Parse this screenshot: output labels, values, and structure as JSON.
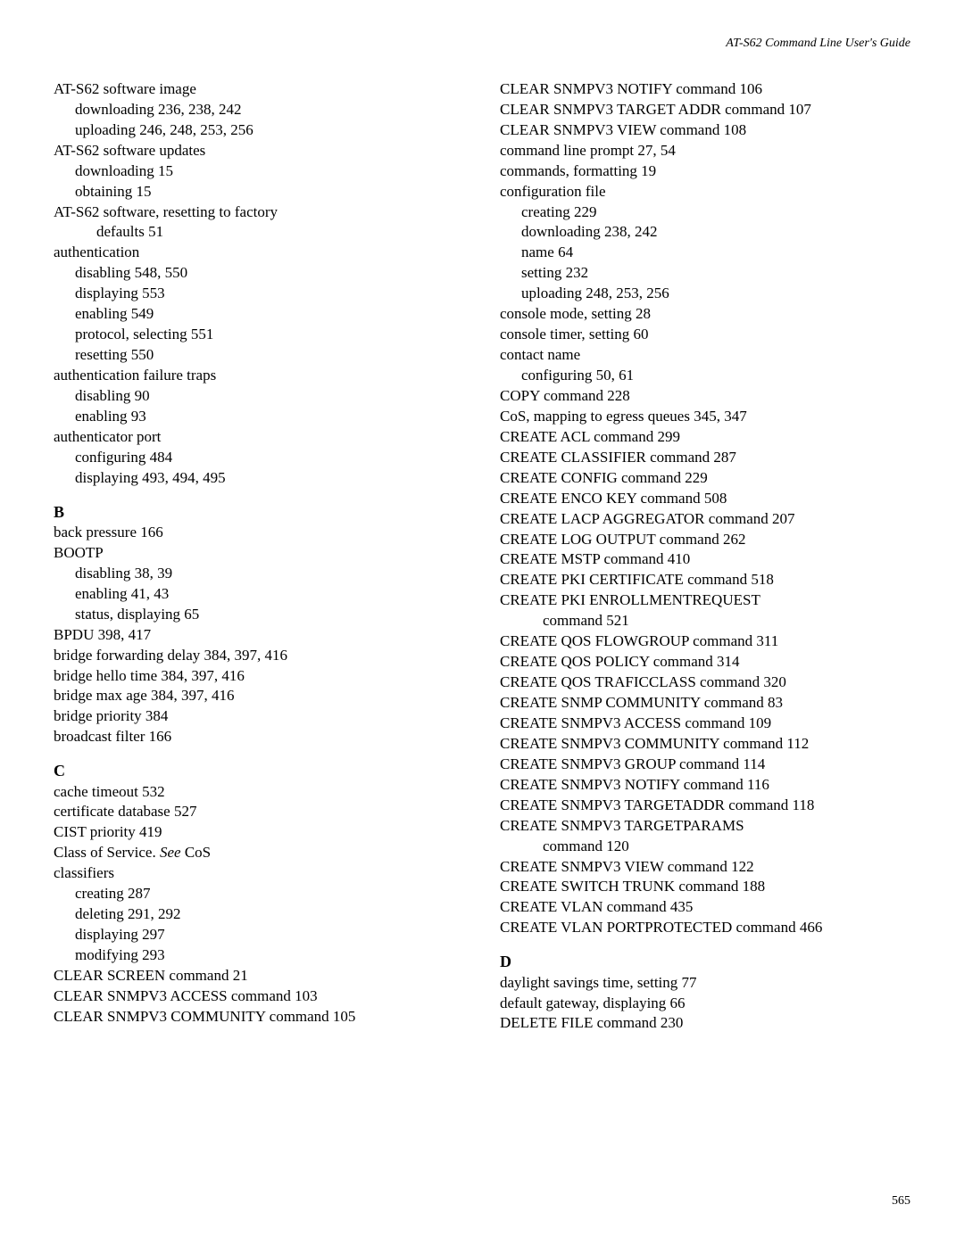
{
  "header": "AT-S62 Command Line User's Guide",
  "page_number": "565",
  "left_column": [
    {
      "text": "AT-S62 software image",
      "indent": 0
    },
    {
      "text": "downloading 236, 238, 242",
      "indent": 1
    },
    {
      "text": "uploading 246, 248, 253, 256",
      "indent": 1
    },
    {
      "text": "AT-S62 software updates",
      "indent": 0
    },
    {
      "text": "downloading 15",
      "indent": 1
    },
    {
      "text": "obtaining 15",
      "indent": 1
    },
    {
      "text": "AT-S62 software, resetting to factory",
      "indent": 0
    },
    {
      "text": "defaults 51",
      "indent": 2
    },
    {
      "text": "authentication",
      "indent": 0
    },
    {
      "text": "disabling 548, 550",
      "indent": 1
    },
    {
      "text": "displaying 553",
      "indent": 1
    },
    {
      "text": "enabling 549",
      "indent": 1
    },
    {
      "text": "protocol, selecting 551",
      "indent": 1
    },
    {
      "text": "resetting 550",
      "indent": 1
    },
    {
      "text": "authentication failure traps",
      "indent": 0
    },
    {
      "text": "disabling 90",
      "indent": 1
    },
    {
      "text": "enabling 93",
      "indent": 1
    },
    {
      "text": "authenticator port",
      "indent": 0
    },
    {
      "text": "configuring 484",
      "indent": 1
    },
    {
      "text": "displaying 493, 494, 495",
      "indent": 1
    },
    {
      "text": "B",
      "indent": 0,
      "section": true
    },
    {
      "text": "back pressure 166",
      "indent": 0
    },
    {
      "text": "BOOTP",
      "indent": 0
    },
    {
      "text": "disabling 38, 39",
      "indent": 1
    },
    {
      "text": "enabling 41, 43",
      "indent": 1
    },
    {
      "text": "status, displaying 65",
      "indent": 1
    },
    {
      "text": "BPDU 398, 417",
      "indent": 0
    },
    {
      "text": "bridge forwarding delay 384, 397, 416",
      "indent": 0
    },
    {
      "text": "bridge hello time 384, 397, 416",
      "indent": 0
    },
    {
      "text": "bridge max age 384, 397, 416",
      "indent": 0
    },
    {
      "text": "bridge priority 384",
      "indent": 0
    },
    {
      "text": "broadcast filter 166",
      "indent": 0
    },
    {
      "text": "C",
      "indent": 0,
      "section": true
    },
    {
      "text": "cache timeout 532",
      "indent": 0
    },
    {
      "text": "certificate database 527",
      "indent": 0
    },
    {
      "text": "CIST priority 419",
      "indent": 0
    },
    {
      "text": "Class of Service. ",
      "indent": 0,
      "see": "See",
      "suffix": " CoS"
    },
    {
      "text": "classifiers",
      "indent": 0
    },
    {
      "text": "creating 287",
      "indent": 1
    },
    {
      "text": "deleting 291, 292",
      "indent": 1
    },
    {
      "text": "displaying 297",
      "indent": 1
    },
    {
      "text": "modifying 293",
      "indent": 1
    },
    {
      "text": "CLEAR SCREEN command 21",
      "indent": 0
    },
    {
      "text": "CLEAR SNMPV3 ACCESS command 103",
      "indent": 0
    },
    {
      "text": "CLEAR SNMPV3 COMMUNITY command 105",
      "indent": 0
    }
  ],
  "right_column": [
    {
      "text": "CLEAR SNMPV3 NOTIFY command 106",
      "indent": 0
    },
    {
      "text": "CLEAR SNMPV3 TARGET ADDR command 107",
      "indent": 0
    },
    {
      "text": "CLEAR SNMPV3 VIEW command 108",
      "indent": 0
    },
    {
      "text": "command line prompt 27, 54",
      "indent": 0
    },
    {
      "text": "commands, formatting 19",
      "indent": 0
    },
    {
      "text": "configuration file",
      "indent": 0
    },
    {
      "text": "creating 229",
      "indent": 1
    },
    {
      "text": "downloading 238, 242",
      "indent": 1
    },
    {
      "text": "name 64",
      "indent": 1
    },
    {
      "text": "setting 232",
      "indent": 1
    },
    {
      "text": "uploading 248, 253, 256",
      "indent": 1
    },
    {
      "text": "console mode, setting 28",
      "indent": 0
    },
    {
      "text": "console timer, setting 60",
      "indent": 0
    },
    {
      "text": "contact name",
      "indent": 0
    },
    {
      "text": "configuring 50, 61",
      "indent": 1
    },
    {
      "text": "COPY command 228",
      "indent": 0
    },
    {
      "text": "CoS, mapping to egress queues 345, 347",
      "indent": 0
    },
    {
      "text": "CREATE ACL command 299",
      "indent": 0
    },
    {
      "text": "CREATE CLASSIFIER command 287",
      "indent": 0
    },
    {
      "text": "CREATE CONFIG command 229",
      "indent": 0
    },
    {
      "text": "CREATE ENCO KEY command 508",
      "indent": 0
    },
    {
      "text": "CREATE LACP AGGREGATOR command 207",
      "indent": 0
    },
    {
      "text": "CREATE LOG OUTPUT command 262",
      "indent": 0
    },
    {
      "text": "CREATE MSTP command 410",
      "indent": 0
    },
    {
      "text": "CREATE PKI CERTIFICATE command 518",
      "indent": 0
    },
    {
      "text": "CREATE PKI ENROLLMENTREQUEST",
      "indent": 0
    },
    {
      "text": "command 521",
      "indent": 2
    },
    {
      "text": "CREATE QOS FLOWGROUP command 311",
      "indent": 0
    },
    {
      "text": "CREATE QOS POLICY command 314",
      "indent": 0
    },
    {
      "text": "CREATE QOS TRAFICCLASS command 320",
      "indent": 0
    },
    {
      "text": "CREATE SNMP COMMUNITY command 83",
      "indent": 0
    },
    {
      "text": "CREATE SNMPV3 ACCESS command 109",
      "indent": 0
    },
    {
      "text": "CREATE SNMPV3 COMMUNITY command 112",
      "indent": 0
    },
    {
      "text": "CREATE SNMPV3 GROUP command 114",
      "indent": 0
    },
    {
      "text": "CREATE SNMPV3 NOTIFY command 116",
      "indent": 0
    },
    {
      "text": "CREATE SNMPV3 TARGETADDR command 118",
      "indent": 0
    },
    {
      "text": "CREATE SNMPV3 TARGETPARAMS",
      "indent": 0
    },
    {
      "text": "command 120",
      "indent": 2
    },
    {
      "text": "CREATE SNMPV3 VIEW command 122",
      "indent": 0
    },
    {
      "text": "CREATE SWITCH TRUNK command 188",
      "indent": 0
    },
    {
      "text": "CREATE VLAN command 435",
      "indent": 0
    },
    {
      "text": "CREATE VLAN PORTPROTECTED command 466",
      "indent": 0
    },
    {
      "text": "D",
      "indent": 0,
      "section": true
    },
    {
      "text": "daylight savings time, setting 77",
      "indent": 0
    },
    {
      "text": "default gateway, displaying 66",
      "indent": 0
    },
    {
      "text": "DELETE FILE command 230",
      "indent": 0
    }
  ]
}
